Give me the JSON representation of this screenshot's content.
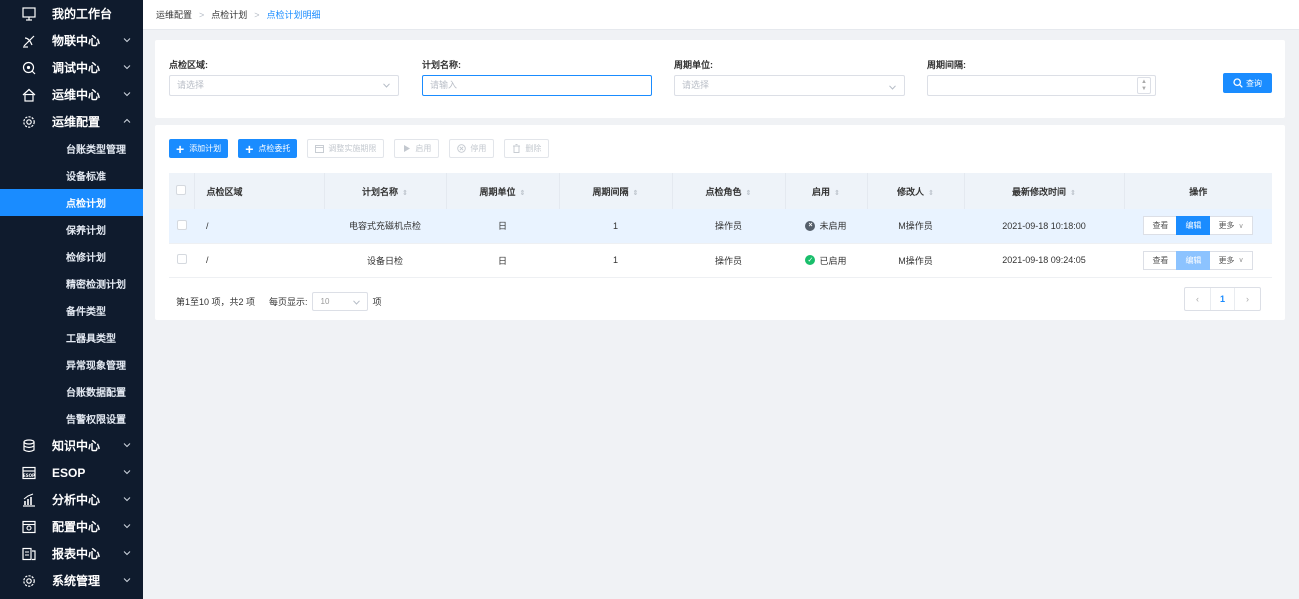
{
  "sidebar": {
    "top_items": [
      {
        "label": "我的工作台",
        "icon": "monitor-icon"
      },
      {
        "label": "物联中心",
        "icon": "satellite-icon"
      },
      {
        "label": "调试中心",
        "icon": "debug-icon"
      },
      {
        "label": "运维中心",
        "icon": "house-icon"
      },
      {
        "label": "运维配置",
        "icon": "gear-icon"
      }
    ],
    "sub_items": [
      "台账类型管理",
      "设备标准",
      "点检计划",
      "保养计划",
      "检修计划",
      "精密检测计划",
      "备件类型",
      "工器具类型",
      "异常现象管理",
      "台账数据配置",
      "告警权限设置"
    ],
    "active_sub": "点检计划",
    "bottom_items": [
      {
        "label": "知识中心",
        "icon": "database-icon"
      },
      {
        "label": "ESOP",
        "icon": "esop-icon"
      },
      {
        "label": "分析中心",
        "icon": "chart-icon"
      },
      {
        "label": "配置中心",
        "icon": "config-icon"
      },
      {
        "label": "报表中心",
        "icon": "report-icon"
      },
      {
        "label": "系统管理",
        "icon": "settings-icon"
      }
    ]
  },
  "breadcrumb": {
    "c1": "运维配置",
    "c2": "点检计划",
    "c3": "点检计划明细"
  },
  "filter": {
    "area_label": "点检区域:",
    "area_placeholder": "请选择",
    "name_label": "计划名称:",
    "name_placeholder": "请输入",
    "unit_label": "周期单位:",
    "unit_placeholder": "请选择",
    "interval_label": "周期间隔:",
    "query_label": "查询"
  },
  "toolbar": {
    "add_plan": "添加计划",
    "delegate": "点检委托",
    "adjust": "调整实施期限",
    "enable": "启用",
    "disable": "停用",
    "delete": "删除"
  },
  "table": {
    "headers": [
      "点检区域",
      "计划名称",
      "周期单位",
      "周期间隔",
      "点检角色",
      "启用",
      "修改人",
      "最新修改时间",
      "操作"
    ],
    "rows": [
      {
        "area": "/",
        "name": "电容式充磁机点检",
        "unit": "日",
        "interval": "1",
        "role": "操作员",
        "status": "未启用",
        "modifier": "M操作员",
        "time": "2021-09-18 10:18:00"
      },
      {
        "area": "/",
        "name": "设备日检",
        "unit": "日",
        "interval": "1",
        "role": "操作员",
        "status": "已启用",
        "modifier": "M操作员",
        "time": "2021-09-18 09:24:05"
      }
    ],
    "ops": {
      "view": "查看",
      "edit": "编辑",
      "more": "更多"
    }
  },
  "pagination": {
    "info": "第1至10 项，共2 项",
    "per_page_label": "每页显示:",
    "page_size": "10",
    "suffix": "项",
    "current_page": "1"
  },
  "colors": {
    "primary": "#1a8cff",
    "sidebar_bg": "#0f1b2d",
    "enabled": "#19be6b",
    "disabled": "#555f6b"
  }
}
